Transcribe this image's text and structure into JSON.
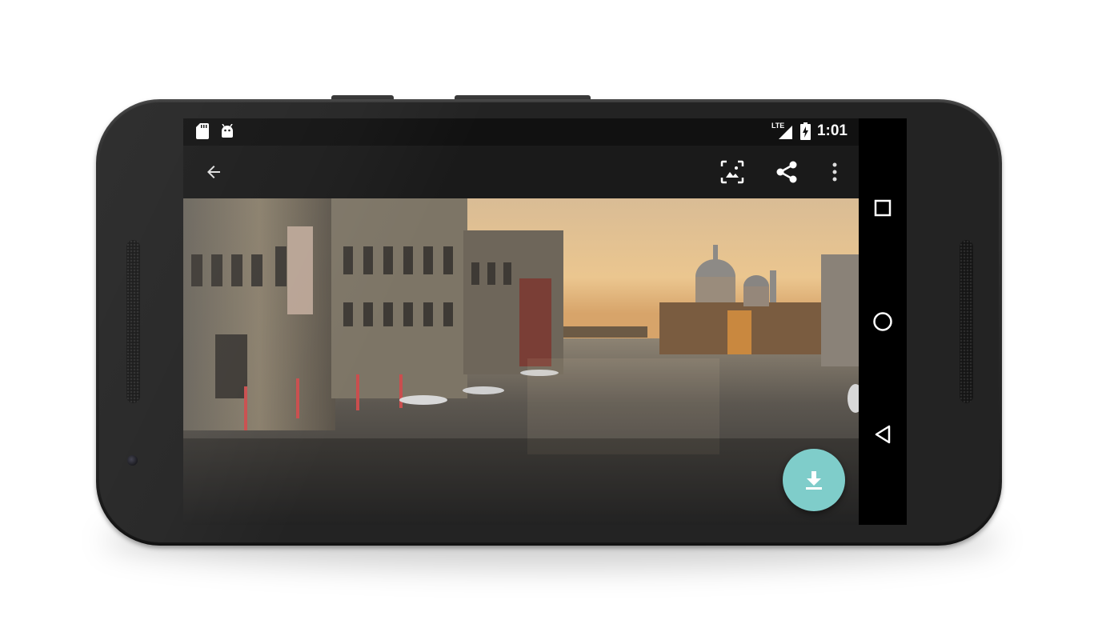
{
  "status_bar": {
    "network_label": "LTE",
    "time": "1:01"
  },
  "app_bar": {
    "icons": [
      "back-arrow-icon",
      "set-wallpaper-icon",
      "share-icon",
      "more-vert-icon"
    ]
  },
  "nav_bar": {
    "icons": [
      "recents-icon",
      "home-icon",
      "back-triangle-icon"
    ]
  },
  "fab": {
    "icon": "download-icon",
    "color": "#7fcdca"
  },
  "photo": {
    "subject": "landscape"
  }
}
